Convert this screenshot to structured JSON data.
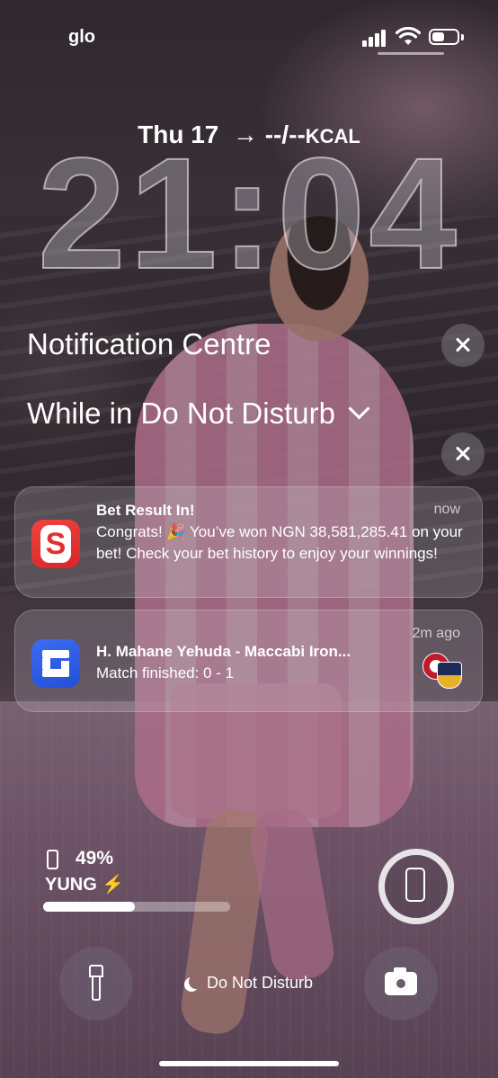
{
  "status_bar": {
    "carrier": "glo",
    "battery_level": 0.49
  },
  "lock_screen": {
    "date": "Thu 17",
    "kcal_value": "--/--",
    "kcal_unit": "KCAL",
    "time": "21:04"
  },
  "notification_centre": {
    "title": "Notification Centre",
    "dnd_group_title": "While in Do Not Disturb"
  },
  "notifications": [
    {
      "app_icon": "sportybet-icon",
      "title": "Bet Result In!",
      "time": "now",
      "body": "Congrats! 🎉 You’ve won NGN 38,581,285.41 on your bet! Check your bet history to enjoy your winnings!"
    },
    {
      "app_icon": "sofascore-icon",
      "title": "H. Mahane Yehuda - Maccabi Iron...",
      "time": "2m ago",
      "body": "Match finished: 0 - 1"
    }
  ],
  "battery_widget": {
    "percent": "49%",
    "device_name": "YUNG",
    "charging_symbol": "⚡",
    "level": 0.49
  },
  "bottom_controls": {
    "focus_label": "Do Not Disturb"
  },
  "colors": {
    "bet_app_red": "#e2302f",
    "score_app_blue": "#2f5fe6"
  }
}
